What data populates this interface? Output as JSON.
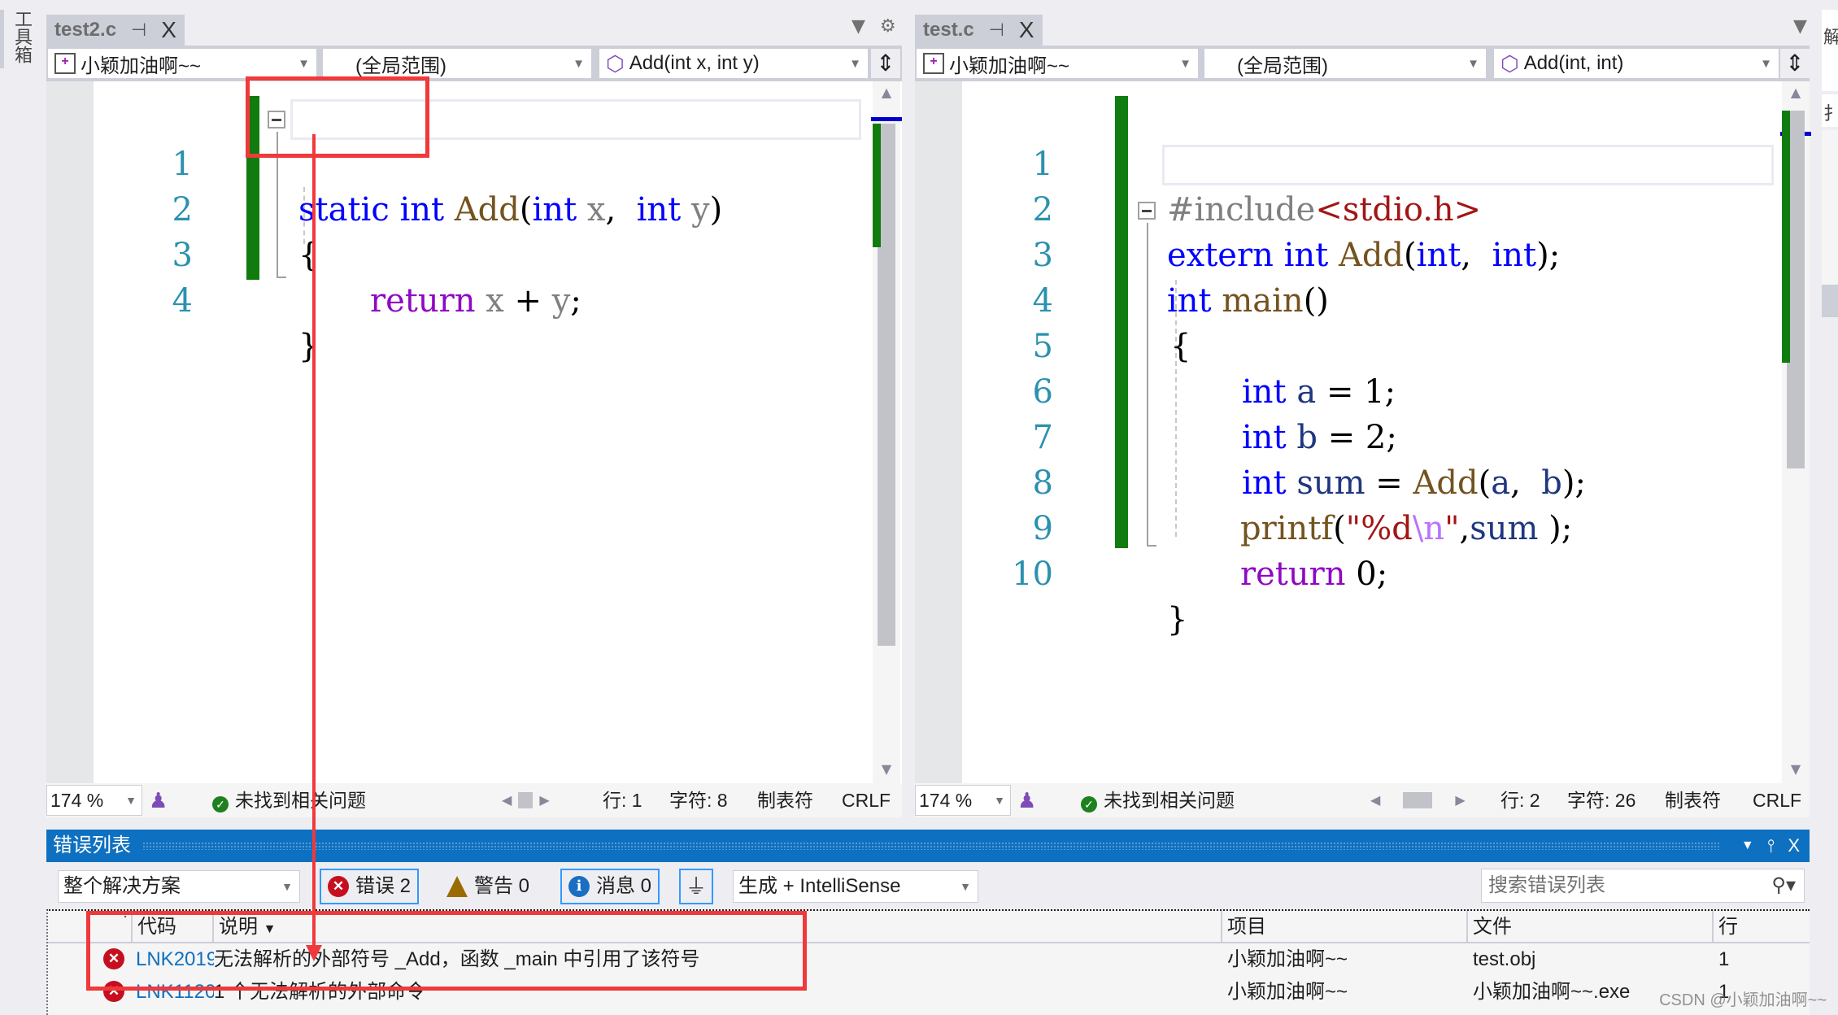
{
  "toolbox": {
    "label": "工具箱"
  },
  "right_strip": {
    "label_top": "解",
    "label_mid": "扌"
  },
  "left_pane": {
    "tab": {
      "title": "test2.c",
      "pin_icon": "⊣",
      "close_icon": "X"
    },
    "nav": {
      "project": "小颖加油啊~~",
      "scope": "(全局范围)",
      "member": "Add(int x, int y)"
    },
    "code_lines": [
      {
        "num": "1"
      },
      {
        "num": "2"
      },
      {
        "num": "3"
      },
      {
        "num": "4"
      }
    ],
    "tokens": {
      "l1": [
        "static",
        "int",
        "Add",
        "(",
        "int",
        "x",
        ",",
        "int",
        "y",
        ")"
      ],
      "l2": [
        "{"
      ],
      "l3": [
        "return",
        "x",
        "+",
        "y",
        ";"
      ],
      "l4": [
        "}"
      ]
    },
    "status": {
      "zoom": "174 %",
      "issues": "未找到相关问题",
      "row": "行: 1",
      "col": "字符: 8",
      "tabs": "制表符",
      "eol": "CRLF"
    }
  },
  "right_pane": {
    "tab": {
      "title": "test.c",
      "pin_icon": "⊣",
      "close_icon": "X"
    },
    "nav": {
      "project": "小颖加油啊~~",
      "scope": "(全局范围)",
      "member": "Add(int, int)"
    },
    "code_lines": [
      {
        "num": "1"
      },
      {
        "num": "2"
      },
      {
        "num": "3"
      },
      {
        "num": "4"
      },
      {
        "num": "5"
      },
      {
        "num": "6"
      },
      {
        "num": "7"
      },
      {
        "num": "8"
      },
      {
        "num": "9"
      },
      {
        "num": "10"
      }
    ],
    "tokens": {
      "l1": [
        "#include",
        "<stdio.h>"
      ],
      "l2": [
        "extern",
        "int",
        "Add",
        "(",
        "int",
        ",",
        "int",
        ")",
        ";"
      ],
      "l3": [
        "int",
        "main",
        "()"
      ],
      "l4": [
        "{"
      ],
      "l5": [
        "int",
        "a",
        "=",
        "1",
        ";"
      ],
      "l6": [
        "int",
        "b",
        "=",
        "2",
        ";"
      ],
      "l7": [
        "int",
        "sum",
        "=",
        "Add",
        "(",
        "a",
        ",",
        "b",
        ")",
        ";"
      ],
      "l8": [
        "printf",
        "(",
        "\"",
        "%d",
        "\\n",
        "\"",
        ",",
        "sum",
        ")",
        ";"
      ],
      "l9": [
        "return",
        "0",
        ";"
      ],
      "l10": [
        "}"
      ]
    },
    "status": {
      "zoom": "174 %",
      "issues": "未找到相关问题",
      "row": "行: 2",
      "col": "字符: 26",
      "tabs": "制表符",
      "eol": "CRLF"
    }
  },
  "error_list": {
    "title": "错误列表",
    "scope_filter": "整个解决方案",
    "errors_btn": "错误 2",
    "warnings_btn": "警告 0",
    "messages_btn": "消息 0",
    "source_filter": "生成 + IntelliSense",
    "search_placeholder": "搜索错误列表",
    "columns": [
      "代码",
      "说明",
      "项目",
      "文件",
      "行"
    ],
    "rows": [
      {
        "code": "LNK2019",
        "desc": "无法解析的外部符号 _Add，函数 _main 中引用了该符号",
        "project": "小颖加油啊~~",
        "file": "test.obj",
        "line": "1"
      },
      {
        "code": "LNK1120",
        "desc": "1 个无法解析的外部命令",
        "project": "小颖加油啊~~",
        "file": "小颖加油啊~~.exe",
        "line": "1"
      }
    ]
  },
  "watermark": "CSDN @小颖加油啊~~",
  "colors": {
    "accent_blue": "#0e70c0",
    "annotation_red": "#f0393a",
    "change_green": "#107c10",
    "error_red": "#c50f1f"
  }
}
